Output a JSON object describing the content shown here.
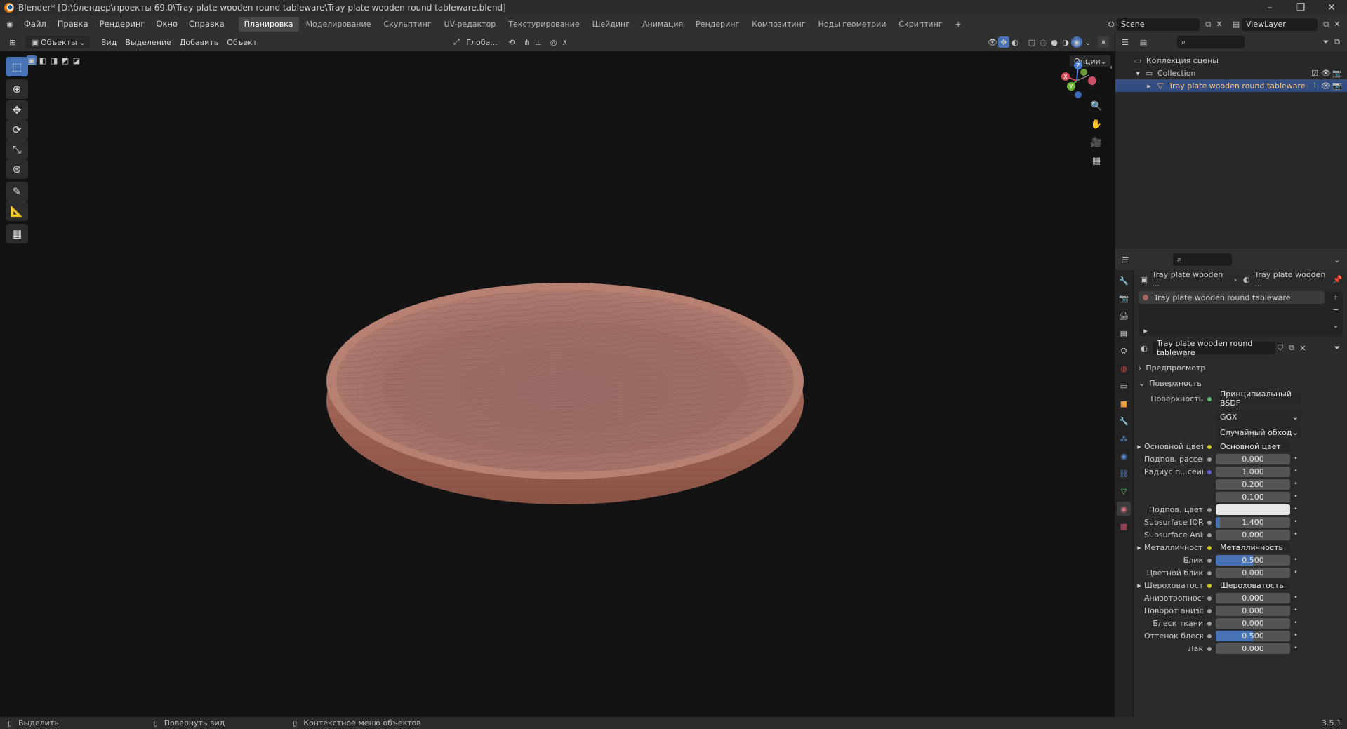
{
  "window": {
    "title": "Blender* [D:\\блендер\\проекты 69.0\\Tray plate wooden round tableware\\Tray plate wooden round tableware.blend]",
    "controls": [
      "–",
      "❐",
      "✕"
    ]
  },
  "menu": [
    "Файл",
    "Правка",
    "Рендеринг",
    "Окно",
    "Справка"
  ],
  "workspaces": {
    "active": "Планировка",
    "tabs": [
      "Моделирование",
      "Скульптинг",
      "UV-редактор",
      "Текстурирование",
      "Шейдинг",
      "Анимация",
      "Рендеринг",
      "Композитинг",
      "Ноды геометрии",
      "Скриптинг"
    ],
    "add": "+"
  },
  "scene": {
    "name": "Scene",
    "view_layer": "ViewLayer"
  },
  "viewport_header": {
    "mode": "Объекты",
    "menus": [
      "Вид",
      "Выделение",
      "Добавить",
      "Объект"
    ],
    "orientation": "Глоба...",
    "options": "Опции"
  },
  "outliner": {
    "root": "Коллекция сцены",
    "collection": "Collection",
    "object": "Tray plate wooden round tableware"
  },
  "properties": {
    "breadcrumb_object": "Tray plate wooden ...",
    "breadcrumb_material": "Tray plate wooden ...",
    "material_slot": "Tray plate wooden round tableware",
    "material_name": "Tray plate wooden round tableware",
    "panel_preview": "Предпросмотр",
    "panel_surface": "Поверхность",
    "surface_label": "Поверхность",
    "surface_value": "Принципиальный BSDF",
    "distribution": "GGX",
    "subsurface_method": "Случайный обход",
    "rows": [
      {
        "label": "Основной цвет",
        "value": "Основной цвет",
        "kind": "link"
      },
      {
        "label": "Подпов. рассеива...",
        "value": "0.000",
        "kind": "num"
      },
      {
        "label": "Радиус п...сеивания",
        "value": "1.000",
        "kind": "num"
      },
      {
        "label": "",
        "value": "0.200",
        "kind": "num"
      },
      {
        "label": "",
        "value": "0.100",
        "kind": "num"
      },
      {
        "label": "Подпов. цвет",
        "value": "",
        "kind": "color"
      },
      {
        "label": "Subsurface IOR",
        "value": "1.400",
        "kind": "slider",
        "fill": 0.06
      },
      {
        "label": "Subsurface Anisotr...",
        "value": "0.000",
        "kind": "num"
      },
      {
        "label": "Металличность",
        "value": "Металличность",
        "kind": "link"
      },
      {
        "label": "Блик",
        "value": "0.500",
        "kind": "slider",
        "fill": 0.5
      },
      {
        "label": "Цветной блик",
        "value": "0.000",
        "kind": "num"
      },
      {
        "label": "Шероховатость",
        "value": "Шероховатость",
        "kind": "link"
      },
      {
        "label": "Анизотропность",
        "value": "0.000",
        "kind": "num"
      },
      {
        "label": "Поворот анизотро...",
        "value": "0.000",
        "kind": "num"
      },
      {
        "label": "Блеск ткани",
        "value": "0.000",
        "kind": "num"
      },
      {
        "label": "Оттенок блеска тк...",
        "value": "0.500",
        "kind": "slider",
        "fill": 0.5
      },
      {
        "label": "Лак",
        "value": "0.000",
        "kind": "num"
      }
    ]
  },
  "statusbar": {
    "select": "Выделить",
    "rotate": "Повернуть вид",
    "context": "Контекстное меню объектов",
    "version": "3.5.1"
  },
  "colors": {
    "accent": "#4772b3",
    "plate": "#a06a60"
  }
}
